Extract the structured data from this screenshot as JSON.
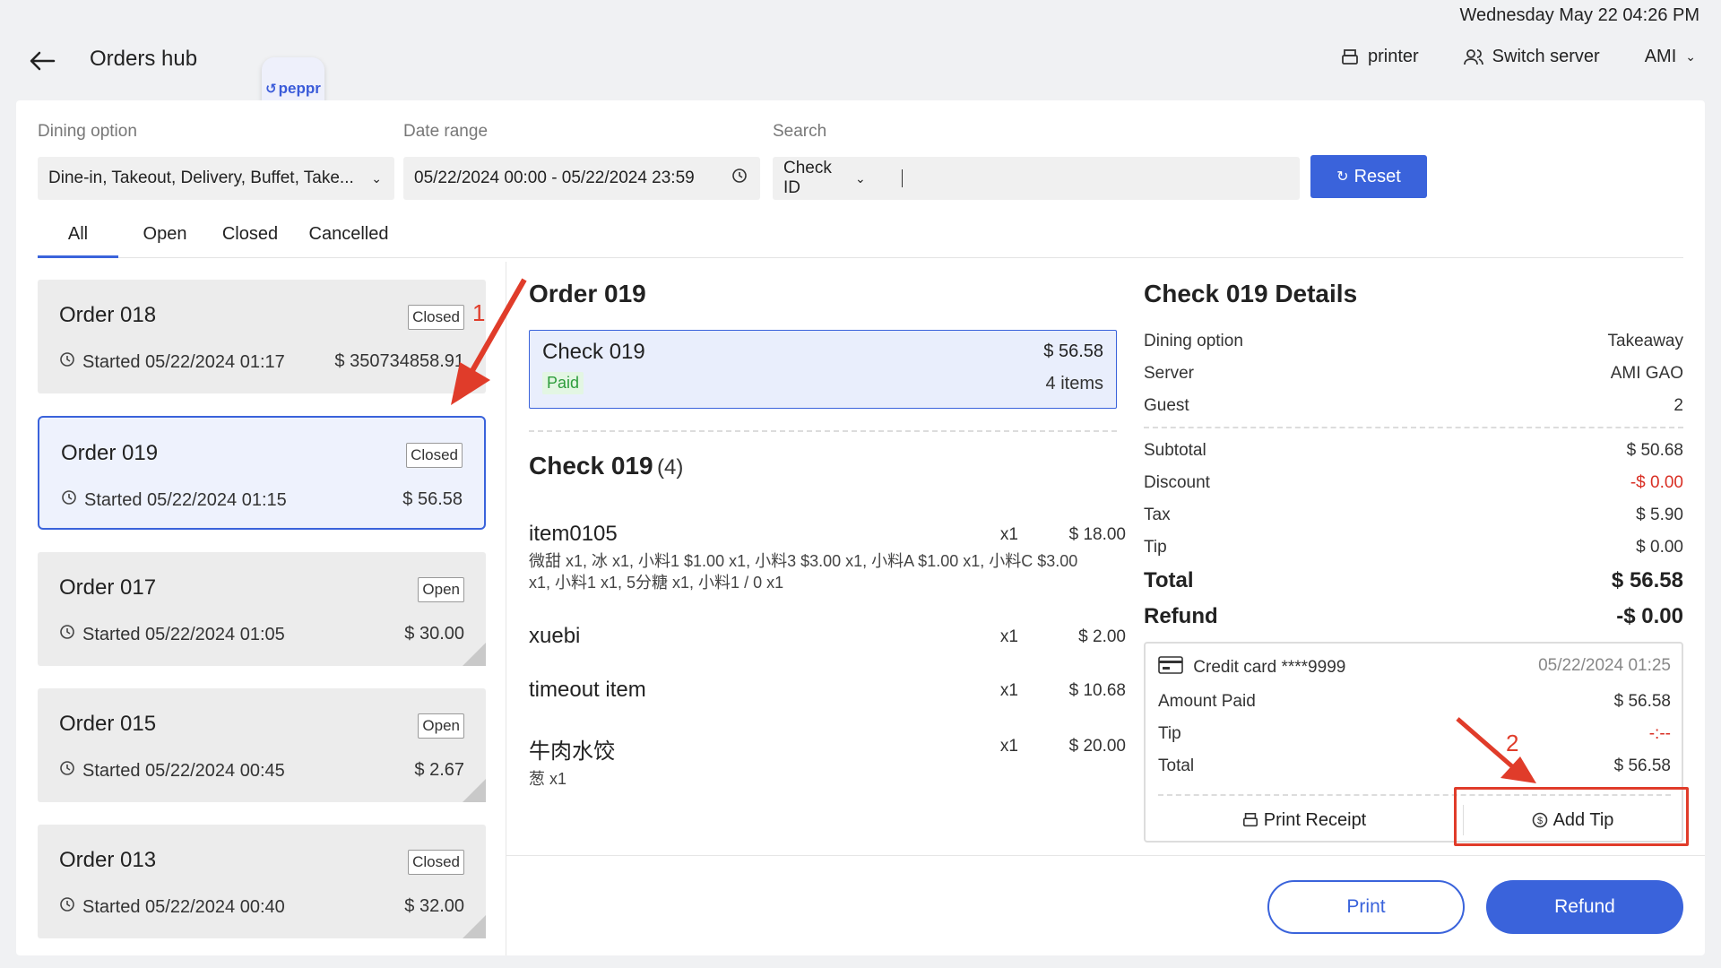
{
  "datetime": "Wednesday May 22 04:26 PM",
  "header": {
    "title": "Orders hub",
    "logo_text": "peppr",
    "printer_label": "printer",
    "switch_server_label": "Switch server",
    "user_label": "AMI"
  },
  "filters": {
    "dining_label": "Dining option",
    "dining_value": "Dine-in, Takeout, Delivery, Buffet, Take...",
    "date_label": "Date range",
    "date_value": "05/22/2024 00:00 - 05/22/2024 23:59",
    "search_label": "Search",
    "search_type": "Check ID",
    "search_value": "",
    "reset_label": "Reset"
  },
  "tabs": [
    "All",
    "Open",
    "Closed",
    "Cancelled"
  ],
  "orders": [
    {
      "name": "Order 018",
      "status": "Closed",
      "started": "Started 05/22/2024 01:17",
      "amount": "$ 350734858.91"
    },
    {
      "name": "Order 019",
      "status": "Closed",
      "started": "Started 05/22/2024 01:15",
      "amount": "$ 56.58"
    },
    {
      "name": "Order 017",
      "status": "Open",
      "started": "Started 05/22/2024 01:05",
      "amount": "$ 30.00"
    },
    {
      "name": "Order 015",
      "status": "Open",
      "started": "Started 05/22/2024 00:45",
      "amount": "$ 2.67"
    },
    {
      "name": "Order 013",
      "status": "Closed",
      "started": "Started 05/22/2024 00:40",
      "amount": "$ 32.00"
    }
  ],
  "order_detail": {
    "title": "Order 019",
    "check_name": "Check 019",
    "check_amount": "$ 56.58",
    "check_status": "Paid",
    "check_items": "4 items",
    "items_header": "Check 019",
    "items_count": "(4)",
    "items": [
      {
        "name": "item0105",
        "qty": "x1",
        "price": "$ 18.00",
        "mods": "微甜 x1, 冰 x1, 小料1 $1.00 x1, 小料3 $3.00 x1, 小料A $1.00 x1, 小料C $3.00 x1, 小料1 x1, 5分糖 x1, 小料1 / 0 x1"
      },
      {
        "name": "xuebi",
        "qty": "x1",
        "price": "$ 2.00",
        "mods": ""
      },
      {
        "name": "timeout item",
        "qty": "x1",
        "price": "$ 10.68",
        "mods": ""
      },
      {
        "name": "牛肉水饺",
        "qty": "x1",
        "price": "$ 20.00",
        "mods": "葱 x1"
      }
    ]
  },
  "check_details": {
    "title": "Check 019 Details",
    "dining_option_label": "Dining option",
    "dining_option_value": "Takeaway",
    "server_label": "Server",
    "server_value": "AMI GAO",
    "guest_label": "Guest",
    "guest_value": "2",
    "subtotal_label": "Subtotal",
    "subtotal_value": "$ 50.68",
    "discount_label": "Discount",
    "discount_value": "-$ 0.00",
    "tax_label": "Tax",
    "tax_value": "$ 5.90",
    "tip_label": "Tip",
    "tip_value": "$ 0.00",
    "total_label": "Total",
    "total_value": "$ 56.58",
    "refund_label": "Refund",
    "refund_value": "-$ 0.00"
  },
  "payment": {
    "method": "Credit card ****9999",
    "time": "05/22/2024 01:25",
    "amount_paid_label": "Amount Paid",
    "amount_paid_value": "$ 56.58",
    "tip_label": "Tip",
    "tip_value": "-:--",
    "total_label": "Total",
    "total_value": "$ 56.58",
    "print_receipt_label": "Print Receipt",
    "add_tip_label": "Add Tip"
  },
  "actions": {
    "print_label": "Print",
    "refund_label": "Refund"
  },
  "annotations": {
    "marker1": "1",
    "marker2": "2"
  },
  "colors": {
    "accent": "#3a63db",
    "annotation": "#e03c2a",
    "paid": "#2e9d3c",
    "discount": "#d93025"
  }
}
